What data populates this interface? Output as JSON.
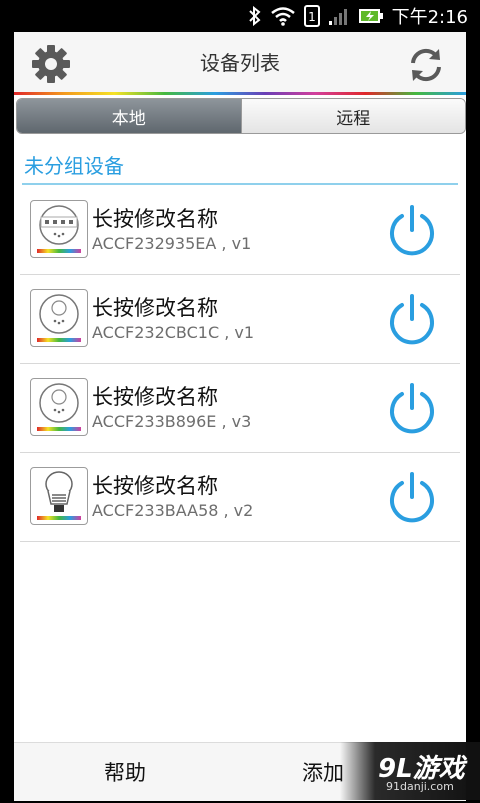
{
  "status_bar": {
    "time": "下午2:16"
  },
  "header": {
    "title": "设备列表"
  },
  "tabs": [
    {
      "label": "本地",
      "active": true
    },
    {
      "label": "远程",
      "active": false
    }
  ],
  "group": {
    "title": "未分组设备"
  },
  "devices": [
    {
      "name": "长按修改名称",
      "id": "ACCF232935EA , v1",
      "icon": "light-strip-controller-icon"
    },
    {
      "name": "长按修改名称",
      "id": "ACCF232CBC1C , v1",
      "icon": "round-controller-icon"
    },
    {
      "name": "长按修改名称",
      "id": "ACCF233B896E , v3",
      "icon": "round-controller-icon"
    },
    {
      "name": "长按修改名称",
      "id": "ACCF233BAA58 , v2",
      "icon": "led-bulb-icon"
    }
  ],
  "bottom_bar": {
    "help": "帮助",
    "add": "添加"
  },
  "watermark": {
    "logo": "9L游戏",
    "url": "91danji.com"
  },
  "colors": {
    "accent": "#2a9ee0",
    "tab_active": "#6a7278"
  }
}
